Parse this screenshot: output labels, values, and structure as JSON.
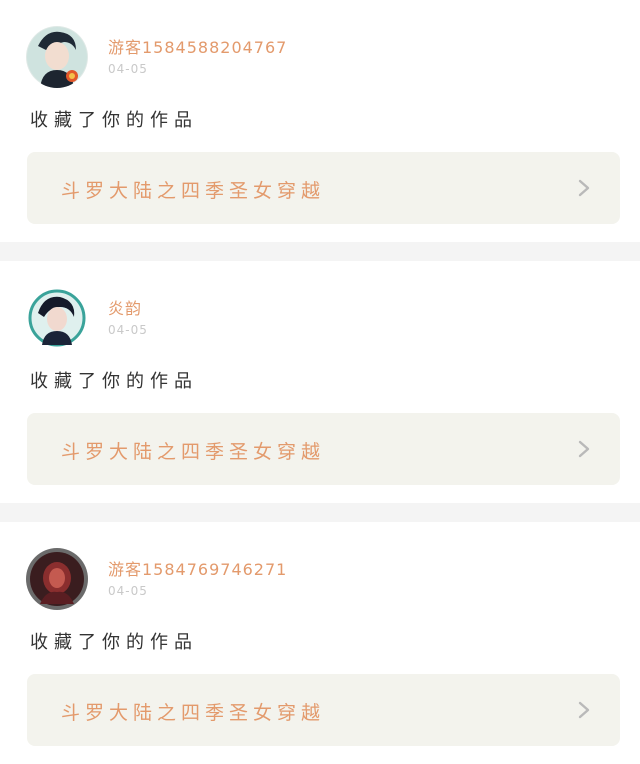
{
  "posts": [
    {
      "user": "游客15845882047​67",
      "date": "04-05",
      "action": "收藏了你的作品",
      "work_title": "斗罗大陆之四季圣女穿越",
      "avatar_icon": "avatar-boy-portrait"
    },
    {
      "user": "炎韵",
      "date": "04-05",
      "action": "收藏了你的作品",
      "work_title": "斗罗大陆之四季圣女穿越",
      "avatar_icon": "avatar-illustrated-portrait"
    },
    {
      "user": "游客15847697462​71",
      "date": "04-05",
      "action": "收藏了你的作品",
      "work_title": "斗罗大陆之四季圣女穿越",
      "avatar_icon": "avatar-red-portrait"
    }
  ],
  "colors": {
    "accent": "#e39a6c",
    "work_bg": "#f3f3ed",
    "date": "#c9c9c9",
    "text": "#333333"
  }
}
